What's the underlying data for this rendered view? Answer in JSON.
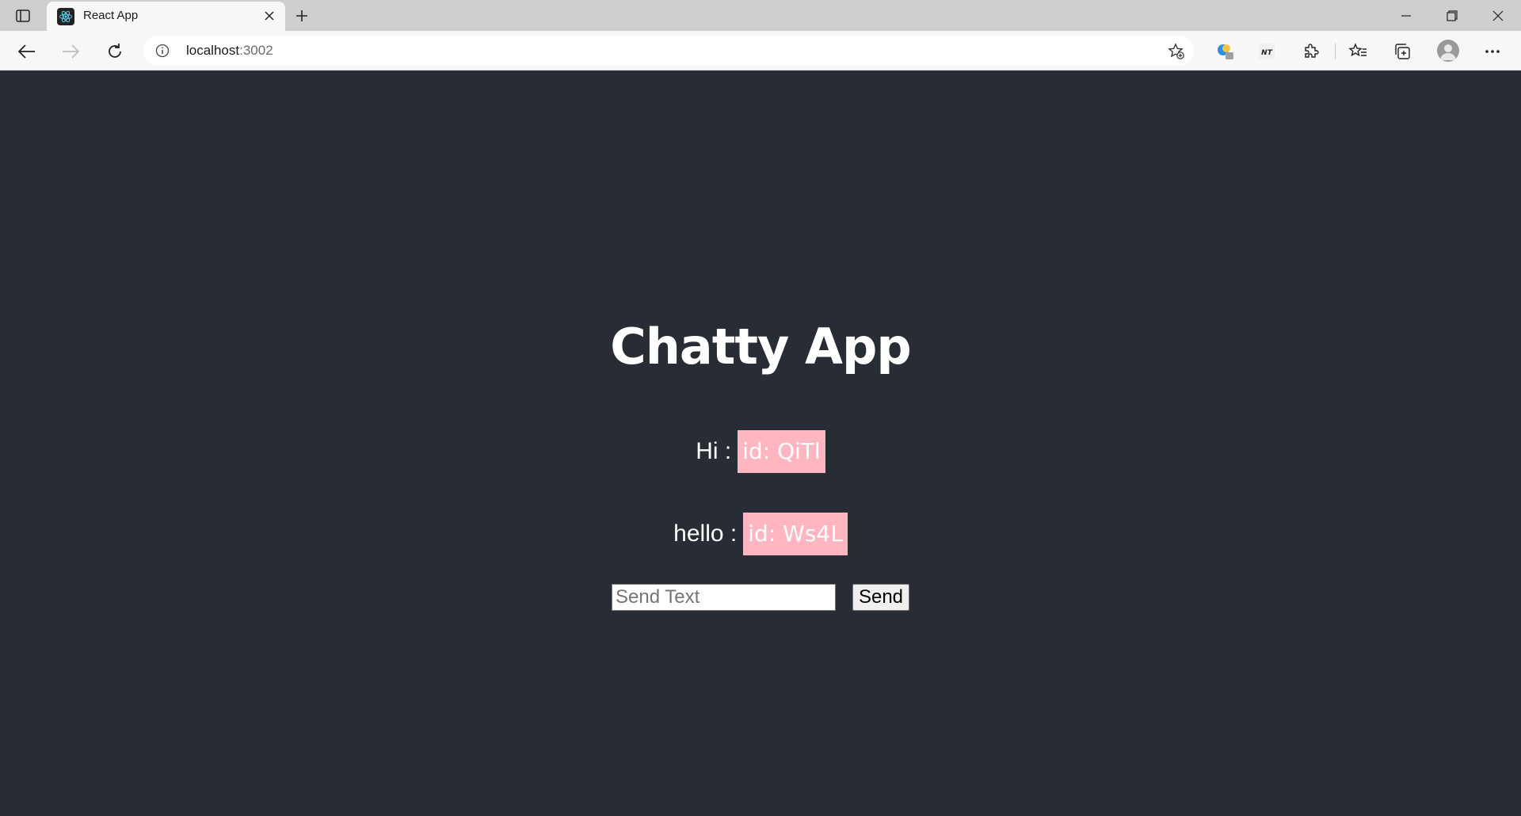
{
  "browser": {
    "tab": {
      "title": "React App"
    },
    "address": {
      "host": "localhost",
      "port": ":3002"
    }
  },
  "app": {
    "title": "Chatty App",
    "messages": [
      {
        "text": "Hi :",
        "id_label": "id: QiTl"
      },
      {
        "text": "hello :",
        "id_label": "id: Ws4L"
      }
    ],
    "composer": {
      "placeholder": "Send Text",
      "value": "",
      "send_label": "Send"
    }
  },
  "colors": {
    "page_background": "#282c34",
    "id_badge": "#ffb6c1",
    "title_text": "#ffffff"
  },
  "icons": {
    "tab_favicon": "react-icon",
    "extensions": [
      "copilot-icon",
      "nt-extension-icon",
      "puzzle-extensions-icon"
    ]
  }
}
